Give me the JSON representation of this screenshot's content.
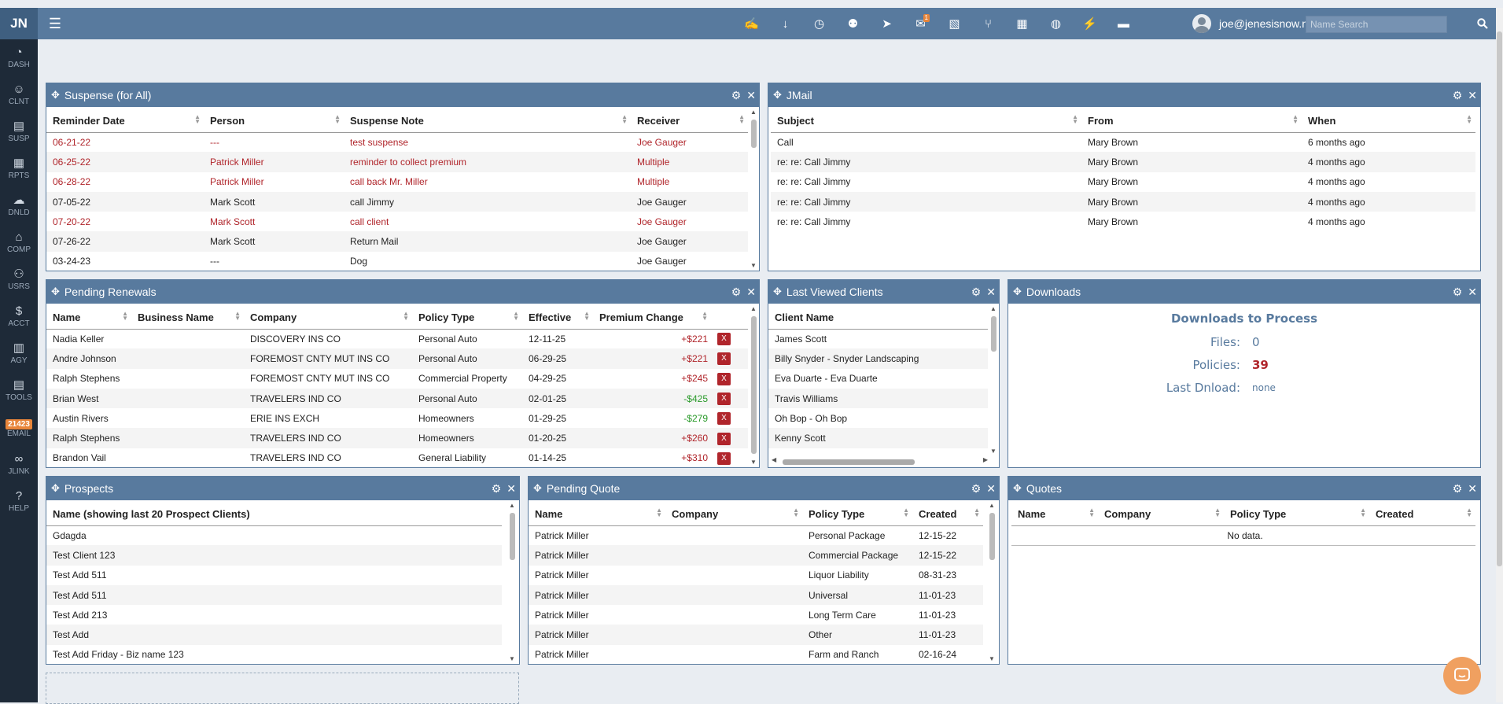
{
  "app": {
    "logo": "JN",
    "user_email": "joe@jenesisnow.net",
    "search_placeholder": "Name Search"
  },
  "sidebar": [
    {
      "label": "DASH",
      "icon": "dashboard-icon"
    },
    {
      "label": "CLNT",
      "icon": "client-icon"
    },
    {
      "label": "SUSP",
      "icon": "suspense-icon"
    },
    {
      "label": "RPTS",
      "icon": "reports-icon"
    },
    {
      "label": "DNLD",
      "icon": "download-cloud-icon"
    },
    {
      "label": "COMP",
      "icon": "bank-icon"
    },
    {
      "label": "USRS",
      "icon": "users-icon"
    },
    {
      "label": "ACCT",
      "icon": "dollar-icon"
    },
    {
      "label": "AGY",
      "icon": "agency-icon"
    },
    {
      "label": "TOOLS",
      "icon": "tools-icon"
    },
    {
      "label": "EMAIL",
      "icon": "email-icon",
      "badge": "21423"
    },
    {
      "label": "JLINK",
      "icon": "link-icon"
    },
    {
      "label": "HELP",
      "icon": "help-icon"
    }
  ],
  "topbar_icons": [
    {
      "name": "signature-icon"
    },
    {
      "name": "arrow-down-icon"
    },
    {
      "name": "clock-icon"
    },
    {
      "name": "add-user-icon"
    },
    {
      "name": "send-icon"
    },
    {
      "name": "mail-icon",
      "badge": "1"
    },
    {
      "name": "pdf-icon"
    },
    {
      "name": "fork-knife-icon"
    },
    {
      "name": "calendar-icon"
    },
    {
      "name": "globe-icon"
    },
    {
      "name": "bolt-icon"
    },
    {
      "name": "id-card-icon"
    }
  ],
  "suspense": {
    "title": "Suspense  (for All)",
    "columns": [
      "Reminder Date",
      "Person",
      "Suspense Note",
      "Receiver"
    ],
    "rows": [
      {
        "cells": [
          "06-21-22",
          "---",
          "test suspense",
          "Joe Gauger"
        ],
        "overdue": true
      },
      {
        "cells": [
          "06-25-22",
          "Patrick Miller",
          "reminder to collect premium",
          "Multiple"
        ],
        "overdue": true
      },
      {
        "cells": [
          "06-28-22",
          "Patrick Miller",
          "call back Mr. Miller",
          "Multiple"
        ],
        "overdue": true
      },
      {
        "cells": [
          "07-05-22",
          "Mark Scott",
          "call Jimmy",
          "Joe Gauger"
        ],
        "overdue": false
      },
      {
        "cells": [
          "07-20-22",
          "Mark Scott",
          "call client",
          "Joe Gauger"
        ],
        "overdue": true
      },
      {
        "cells": [
          "07-26-22",
          "Mark Scott",
          "Return Mail",
          "Joe Gauger"
        ],
        "overdue": false
      },
      {
        "cells": [
          "03-24-23",
          "---",
          "Dog",
          "Joe Gauger"
        ],
        "overdue": false
      }
    ]
  },
  "jmail": {
    "title": "JMail",
    "columns": [
      "Subject",
      "From",
      "When"
    ],
    "rows": [
      [
        "Call",
        "Mary Brown",
        "6 months ago"
      ],
      [
        "re: re: Call Jimmy",
        "Mary Brown",
        "4 months ago"
      ],
      [
        "re: re: Call Jimmy",
        "Mary Brown",
        "4 months ago"
      ],
      [
        "re: re: Call Jimmy",
        "Mary Brown",
        "4 months ago"
      ],
      [
        "re: re: Call Jimmy",
        "Mary Brown",
        "4 months ago"
      ]
    ]
  },
  "renewals": {
    "title": "Pending Renewals",
    "columns": [
      "Name",
      "Business Name",
      "Company",
      "Policy Type",
      "Effective",
      "Premium Change"
    ],
    "remove_label": "X",
    "rows": [
      {
        "cells": [
          "Nadia Keller",
          "",
          "DISCOVERY INS CO",
          "Personal Auto",
          "12-11-25",
          "+$221"
        ],
        "dir": "pos"
      },
      {
        "cells": [
          "Andre Johnson",
          "",
          "FOREMOST CNTY MUT INS CO",
          "Personal Auto",
          "06-29-25",
          "+$221"
        ],
        "dir": "pos"
      },
      {
        "cells": [
          "Ralph Stephens",
          "",
          "FOREMOST CNTY MUT INS CO",
          "Commercial Property",
          "04-29-25",
          "+$245"
        ],
        "dir": "pos"
      },
      {
        "cells": [
          "Brian West",
          "",
          "TRAVELERS IND CO",
          "Personal Auto",
          "02-01-25",
          "-$425"
        ],
        "dir": "neg"
      },
      {
        "cells": [
          "Austin Rivers",
          "",
          "ERIE INS EXCH",
          "Homeowners",
          "01-29-25",
          "-$279"
        ],
        "dir": "neg"
      },
      {
        "cells": [
          "Ralph Stephens",
          "",
          "TRAVELERS IND CO",
          "Homeowners",
          "01-20-25",
          "+$260"
        ],
        "dir": "pos"
      },
      {
        "cells": [
          "Brandon Vail",
          "",
          "TRAVELERS IND CO",
          "General Liability",
          "01-14-25",
          "+$310"
        ],
        "dir": "pos"
      }
    ]
  },
  "last_viewed": {
    "title": "Last Viewed Clients",
    "columns": [
      "Client Name"
    ],
    "rows": [
      [
        "James Scott"
      ],
      [
        "Billy Snyder - Snyder Landscaping"
      ],
      [
        "Eva Duarte - Eva Duarte"
      ],
      [
        "Travis Williams"
      ],
      [
        "Oh Bop - Oh Bop"
      ],
      [
        "Kenny Scott"
      ]
    ]
  },
  "downloads": {
    "title": "Downloads",
    "heading": "Downloads to Process",
    "files_label": "Files:",
    "files_value": "0",
    "policies_label": "Policies:",
    "policies_value": "39",
    "last_label": "Last Dnload:",
    "last_value": "none"
  },
  "prospects": {
    "title": "Prospects",
    "columns": [
      "Name (showing last 20 Prospect Clients)"
    ],
    "rows": [
      [
        "Gdagda"
      ],
      [
        "Test Client 123"
      ],
      [
        "Test Add 511"
      ],
      [
        "Test Add 511"
      ],
      [
        "Test Add 213"
      ],
      [
        "Test Add"
      ],
      [
        "Test Add Friday - Biz name 123"
      ]
    ]
  },
  "pending_quote": {
    "title": "Pending Quote",
    "columns": [
      "Name",
      "Company",
      "Policy Type",
      "Created"
    ],
    "rows": [
      [
        "Patrick Miller",
        "",
        "Personal Package",
        "12-15-22"
      ],
      [
        "Patrick Miller",
        "",
        "Commercial Package",
        "12-15-22"
      ],
      [
        "Patrick Miller",
        "",
        "Liquor Liability",
        "08-31-23"
      ],
      [
        "Patrick Miller",
        "",
        "Universal",
        "11-01-23"
      ],
      [
        "Patrick Miller",
        "",
        "Long Term Care",
        "11-01-23"
      ],
      [
        "Patrick Miller",
        "",
        "Other",
        "11-01-23"
      ],
      [
        "Patrick Miller",
        "",
        "Farm and Ranch",
        "02-16-24"
      ]
    ]
  },
  "quotes": {
    "title": "Quotes",
    "columns": [
      "Name",
      "Company",
      "Policy Type",
      "Created"
    ],
    "empty": "No data."
  },
  "colors": {
    "header": "#587a9e",
    "sidebar": "#1e2a38",
    "overdue": "#b0252b",
    "negative": "#2a9a2a",
    "badge": "#e8853a"
  }
}
